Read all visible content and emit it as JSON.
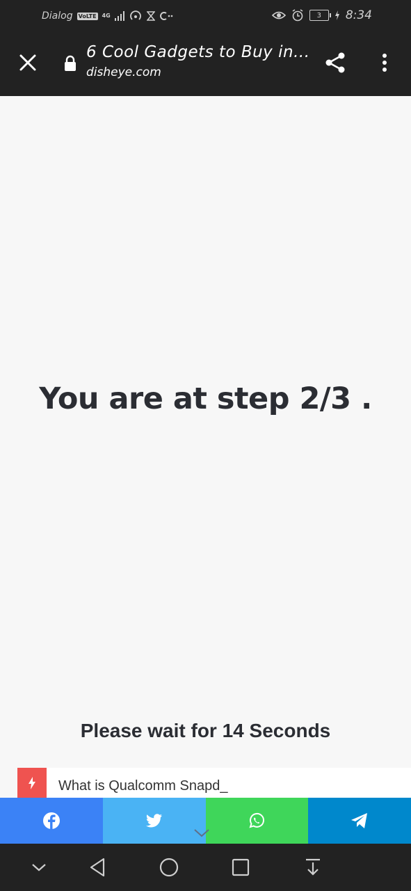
{
  "status_bar": {
    "carrier": "Dialog",
    "volte": "VoLTE",
    "network": "4G",
    "battery_level": "3",
    "time": "8:34"
  },
  "browser": {
    "page_title": "6 Cool Gadgets to Buy in...",
    "url": "disheye.com",
    "icons": [
      "close-icon",
      "lock-icon",
      "share-icon",
      "more-vert-icon"
    ]
  },
  "content": {
    "step_text": "You are at step 2/3 .",
    "wait_text": "Please wait for 14 Seconds"
  },
  "related": {
    "title": "What is Qualcomm Snapd_",
    "accent_color": "#ef5350"
  },
  "share_bar": {
    "items": [
      {
        "name": "facebook",
        "color": "#3b82f6"
      },
      {
        "name": "twitter",
        "color": "#4ab3f4"
      },
      {
        "name": "whatsapp",
        "color": "#3fd65a"
      },
      {
        "name": "telegram",
        "color": "#0088cc"
      }
    ]
  },
  "nav_bar": {
    "buttons": [
      "chevron-down-icon",
      "back-icon",
      "home-icon",
      "recents-icon",
      "notification-pull-icon"
    ]
  }
}
